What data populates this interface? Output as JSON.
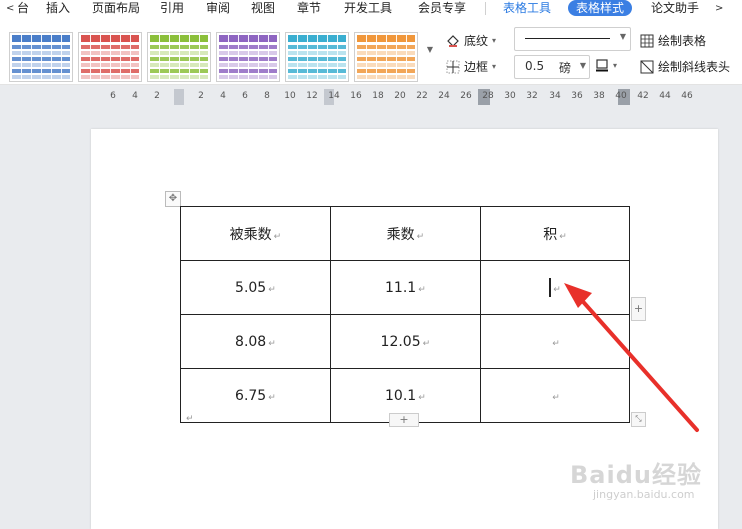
{
  "menu": {
    "left_arrow": "<",
    "right_arrow": ">",
    "items": [
      "台",
      "插入",
      "页面布局",
      "引用",
      "审阅",
      "视图",
      "章节",
      "开发工具",
      "会员专享"
    ],
    "context_tabs": [
      "表格工具",
      "表格样式"
    ],
    "extra_item": "论文助手",
    "active_tab": "表格样式",
    "accent_color": "#3b7fe3"
  },
  "ribbon": {
    "table_style_colors": [
      "#4a7ec9",
      "#d9534f",
      "#8bbf3a",
      "#8e65c1",
      "#3aaed0",
      "#f0973b"
    ],
    "shading_label": "底纹",
    "border_label": "边框",
    "line_weight": "0.5",
    "line_weight_unit": "磅",
    "draw_table_label": "绘制表格",
    "draw_diagonal_label": "绘制斜线表头"
  },
  "ruler": {
    "ticks": [
      "6",
      "4",
      "2",
      "2",
      "4",
      "6",
      "8",
      "10",
      "12",
      "14",
      "16",
      "18",
      "20",
      "22",
      "24",
      "26",
      "28",
      "30",
      "32",
      "34",
      "36",
      "38",
      "40",
      "42",
      "44",
      "46"
    ]
  },
  "table": {
    "headers": [
      "被乘数",
      "乘数",
      "积"
    ],
    "rows": [
      [
        "5.05",
        "11.1",
        ""
      ],
      [
        "8.08",
        "12.05",
        ""
      ],
      [
        "6.75",
        "10.1",
        ""
      ]
    ],
    "paragraph_mark": "↵"
  },
  "controls": {
    "add_symbol": "+"
  },
  "watermark": {
    "brand": "Baidu经验",
    "url": "jingyan.baidu.com"
  }
}
